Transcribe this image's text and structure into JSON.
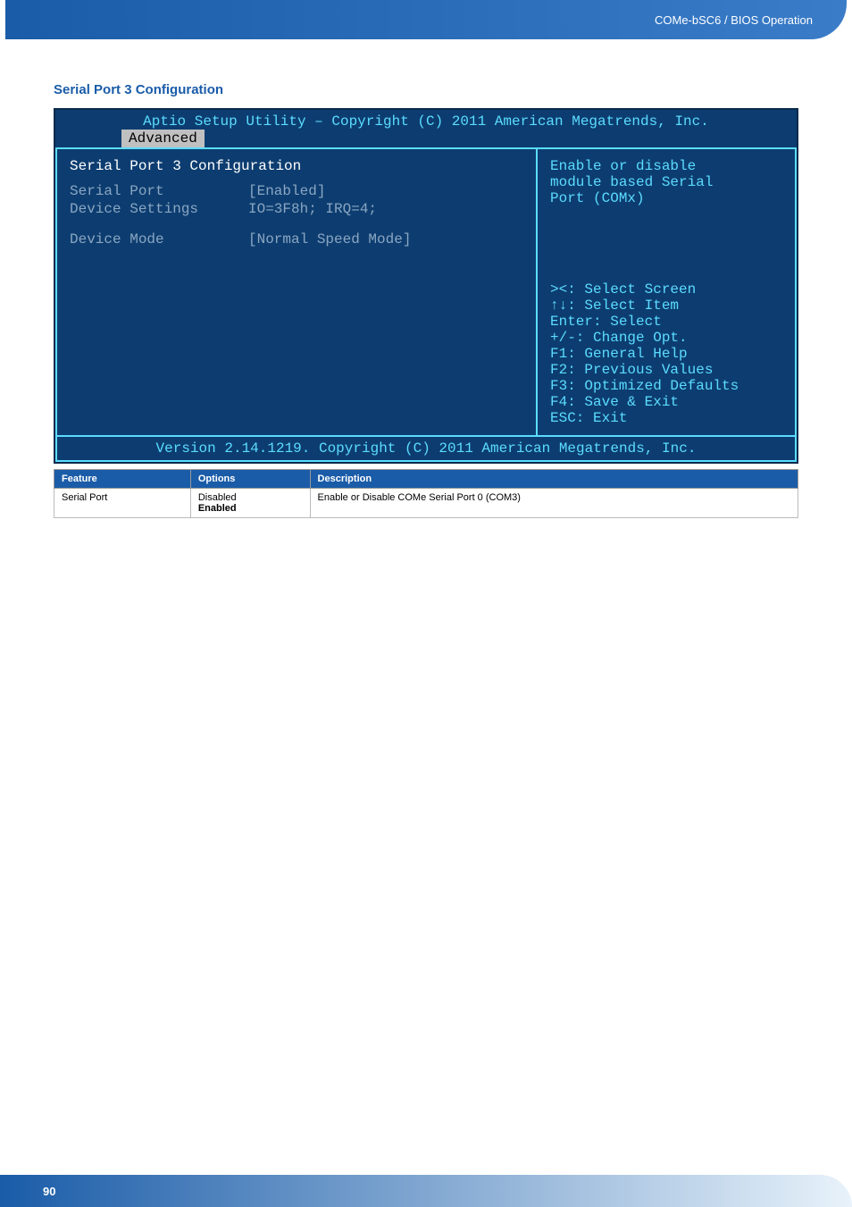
{
  "header": {
    "breadcrumb": "COMe-bSC6 / BIOS Operation"
  },
  "section": {
    "title": "Serial Port 3 Configuration"
  },
  "bios": {
    "top_title": "Aptio Setup Utility – Copyright (C) 2011 American Megatrends, Inc.",
    "tab": "Advanced",
    "page_heading": "Serial Port 3 Configuration",
    "rows": [
      {
        "label": "Serial Port",
        "value": "[Enabled]"
      },
      {
        "label": "Device Settings",
        "value": "IO=3F8h; IRQ=4;"
      },
      {
        "label": "Device Mode",
        "value": "[Normal Speed Mode]"
      }
    ],
    "help_top": "Enable or disable\nmodule based Serial\nPort (COMx)",
    "help_bottom": "><: Select Screen\n↑↓: Select Item\nEnter: Select\n+/-: Change Opt.\nF1: General Help\nF2: Previous Values\nF3: Optimized Defaults\nF4: Save & Exit\nESC: Exit",
    "bottom": "Version 2.14.1219. Copyright (C) 2011 American Megatrends, Inc."
  },
  "table": {
    "headers": {
      "feature": "Feature",
      "options": "Options",
      "description": "Description"
    },
    "row": {
      "feature": "Serial Port",
      "opt1": "Disabled",
      "opt2": "Enabled",
      "description": "Enable or Disable COMe Serial Port 0 (COM3)"
    }
  },
  "footer": {
    "page_number": "90"
  }
}
